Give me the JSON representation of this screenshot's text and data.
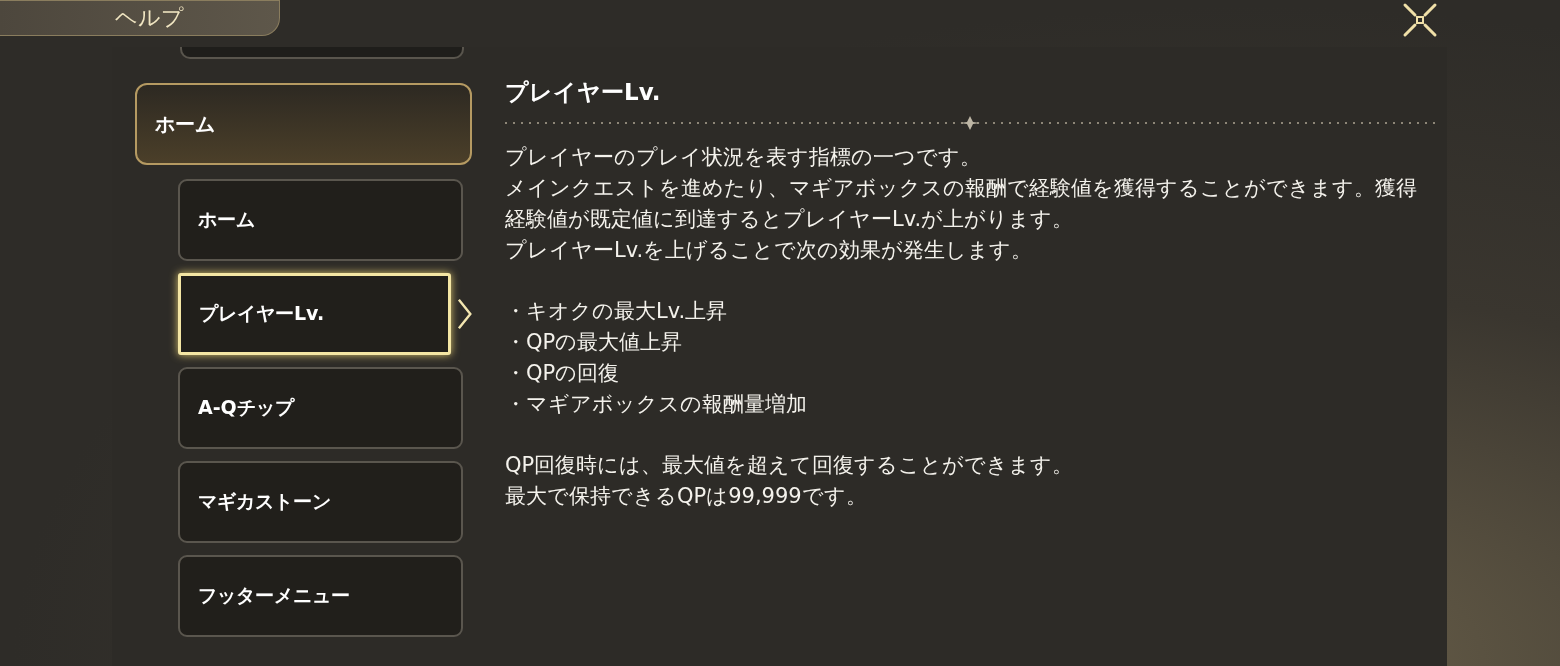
{
  "header": {
    "title": "ヘルプ"
  },
  "sidebar": {
    "category": {
      "label": "ホーム",
      "expanded": true
    },
    "items": [
      {
        "label": "ホーム",
        "selected": false
      },
      {
        "label": "プレイヤーLv.",
        "selected": true
      },
      {
        "label": "A-Qチップ",
        "selected": false
      },
      {
        "label": "マギカストーン",
        "selected": false
      },
      {
        "label": "フッターメニュー",
        "selected": false
      }
    ]
  },
  "article": {
    "title": "プレイヤーLv.",
    "paragraphs": [
      "プレイヤーのプレイ状況を表す指標の一つです。",
      "メインクエストを進めたり、マギアボックスの報酬で経験値を獲得することができます。獲得経験値が既定値に到達するとプレイヤーLv.が上がります。",
      "プレイヤーLv.を上げることで次の効果が発生します。"
    ],
    "bullets": [
      "・キオクの最大Lv.上昇",
      "・QPの最大値上昇",
      "・QPの回復",
      "・マギアボックスの報酬量増加"
    ],
    "notes": [
      "QP回復時には、最大値を超えて回復することができます。",
      "最大で保持できるQPは99,999です。"
    ]
  }
}
